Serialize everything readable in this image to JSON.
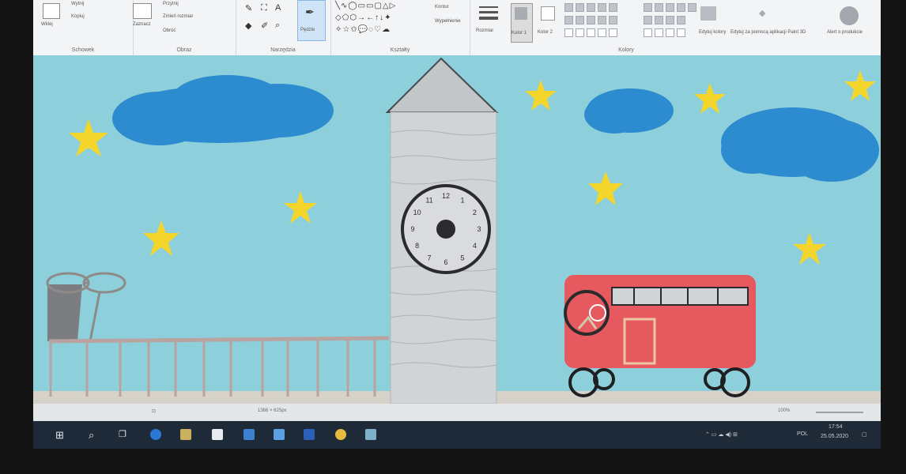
{
  "ribbon": {
    "groups": {
      "clipboard": "Schowek",
      "image": "Obraz",
      "tools": "Narzędzia",
      "shapes": "Kształty",
      "colors": "Kolory"
    },
    "buttons": {
      "paste": "Wklej",
      "cut": "Wytnij",
      "copy": "Kopiuj",
      "select": "Zaznacz",
      "crop": "Przytnij",
      "resize": "Zmień rozmiar",
      "rotate": "Obróć",
      "text_tool": "A",
      "brushes": "Pędzle",
      "outline": "Kontur",
      "fill": "Wypełnienie",
      "size": "Rozmiar",
      "color1": "Kolor 1",
      "color2": "Kolor 2",
      "edit_colors": "Edytuj kolory",
      "paint3d": "Edytuj za pomocą aplikacji Paint 3D",
      "product_alert": "Alert o produkcie"
    }
  },
  "drawing": {
    "clock_numbers": [
      "12",
      "1",
      "2",
      "3",
      "4",
      "5",
      "6",
      "7",
      "8",
      "9",
      "10",
      "11"
    ],
    "colors": {
      "sky": "#8ecfdc",
      "cloud": "#2d8ccf",
      "star": "#f3d52c",
      "tower": "#d1d4d7",
      "bus": "#e65a5f",
      "fence": "#b9a3a1",
      "ground": "#d7d2c9"
    }
  },
  "status": {
    "dimensions": "1366 × 625px",
    "zoom": "100%"
  },
  "taskbar": {
    "lang": "POL",
    "time": "17:54",
    "date": "25.05.2020"
  }
}
